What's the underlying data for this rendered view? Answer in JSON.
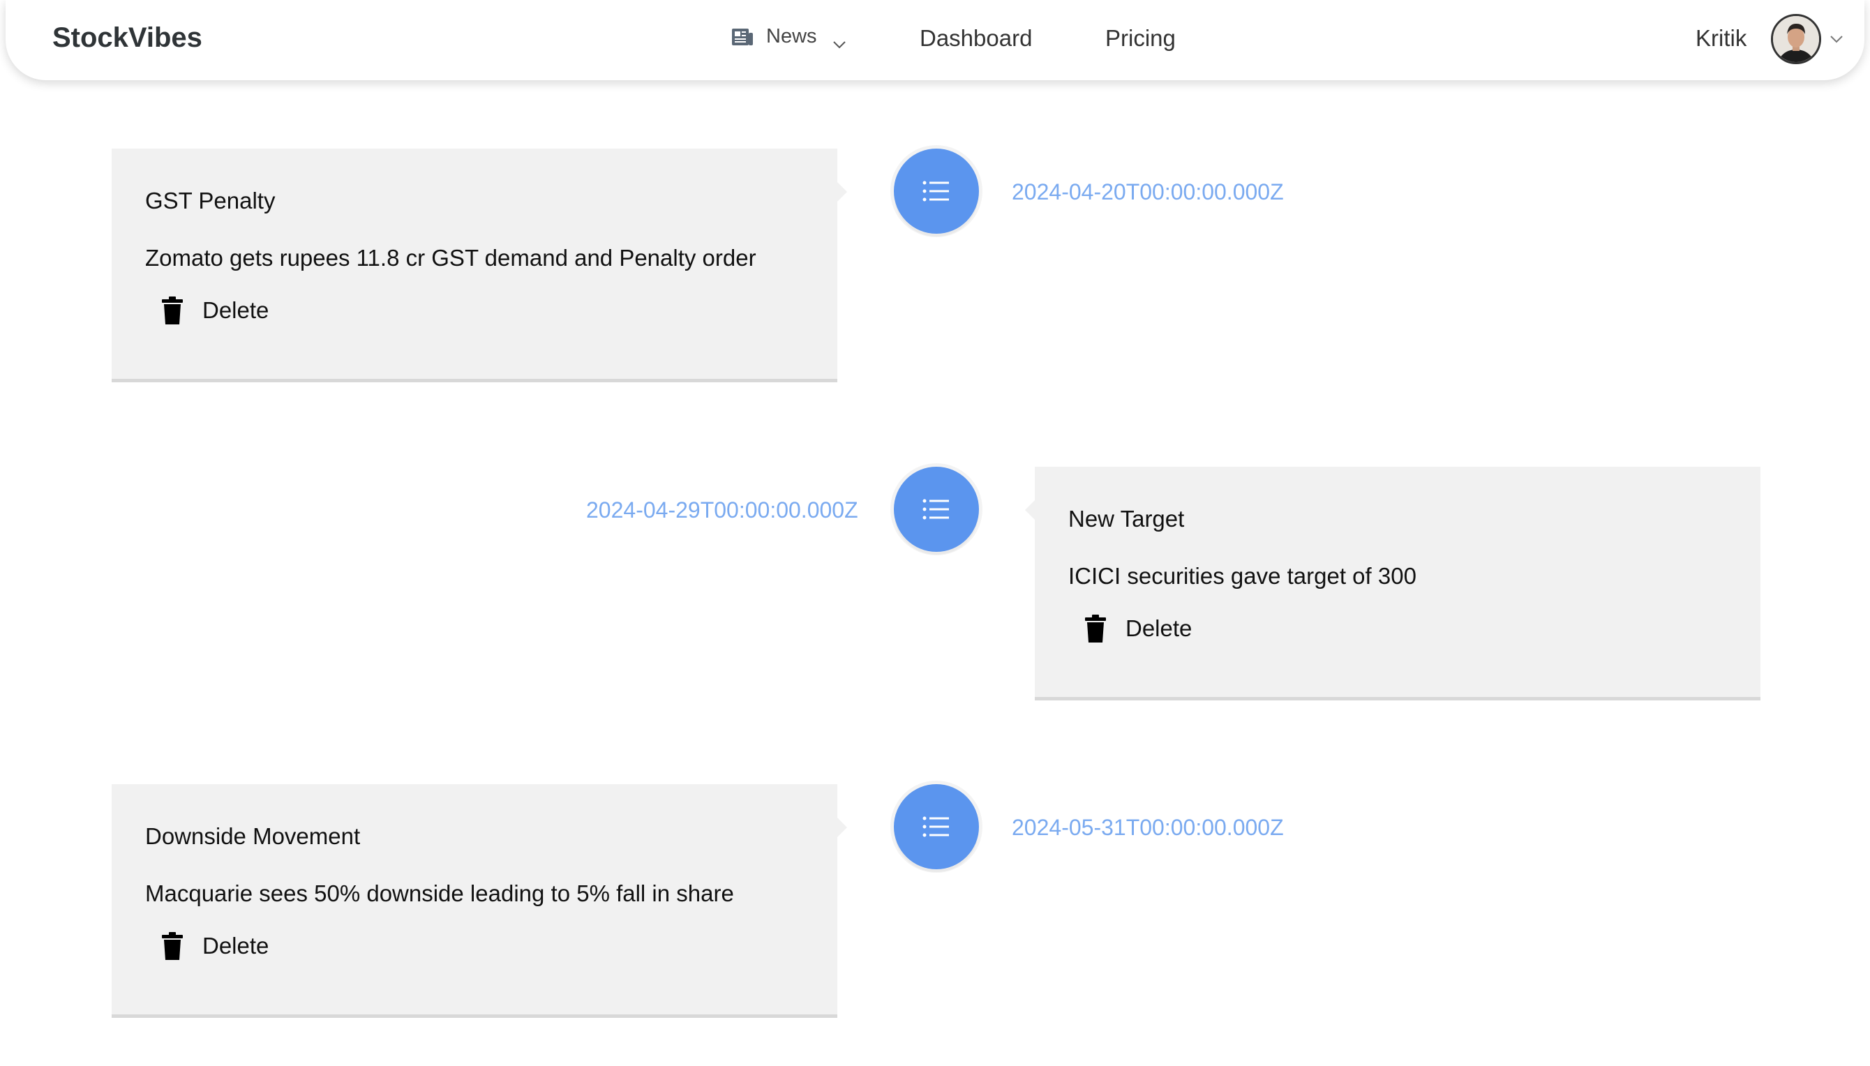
{
  "header": {
    "brand": "StockVibes",
    "nav": {
      "news_label": "News",
      "dashboard_label": "Dashboard",
      "pricing_label": "Pricing"
    },
    "user": {
      "name": "Kritik"
    }
  },
  "timeline": {
    "items": [
      {
        "title": "GST Penalty",
        "body": "Zomato gets rupees 11.8 cr GST demand and Penalty order",
        "delete_label": "Delete",
        "date": "2024-04-20T00:00:00.000Z",
        "side": "left"
      },
      {
        "title": "New Target",
        "body": "ICICI securities gave target of 300",
        "delete_label": "Delete",
        "date": "2024-04-29T00:00:00.000Z",
        "side": "right"
      },
      {
        "title": "Downside Movement",
        "body": "Macquarie sees 50% downside leading to 5% fall in share",
        "delete_label": "Delete",
        "date": "2024-05-31T00:00:00.000Z",
        "side": "left"
      }
    ]
  },
  "icons": {
    "news": "newspaper-icon",
    "dropdown": "chevron-down-icon",
    "timeline_marker": "list-icon",
    "delete": "trash-icon"
  },
  "colors": {
    "accent": "#5b95ee",
    "date_text": "#7aaaf0",
    "card_bg": "#f1f1f1"
  }
}
